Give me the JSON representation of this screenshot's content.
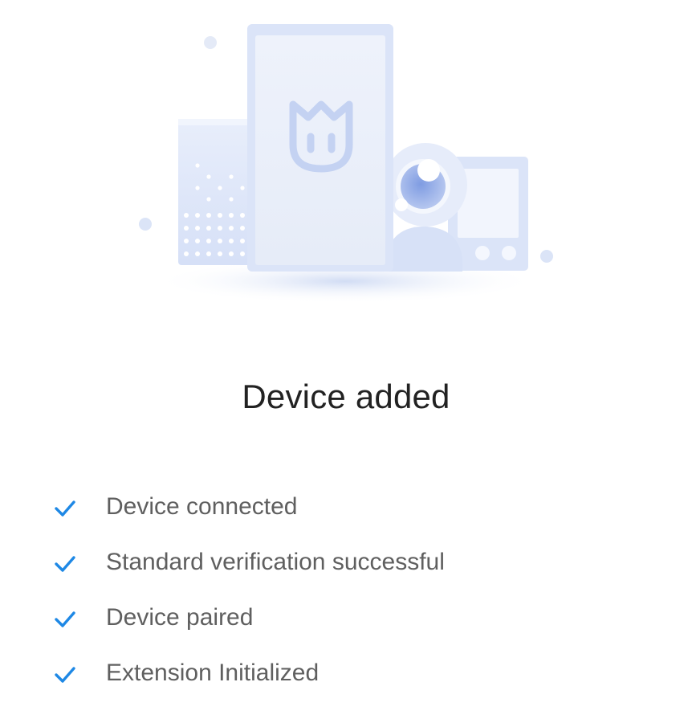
{
  "illustration": {
    "icon": "mi-home-devices-illustration",
    "logo": "mi-home-logo-icon"
  },
  "title": "Device added",
  "accent_color": "#1e88e5",
  "steps": [
    {
      "label": "Device connected",
      "icon": "check-icon"
    },
    {
      "label": "Standard verification successful",
      "icon": "check-icon"
    },
    {
      "label": "Device paired",
      "icon": "check-icon"
    },
    {
      "label": "Extension Initialized",
      "icon": "check-icon"
    }
  ]
}
